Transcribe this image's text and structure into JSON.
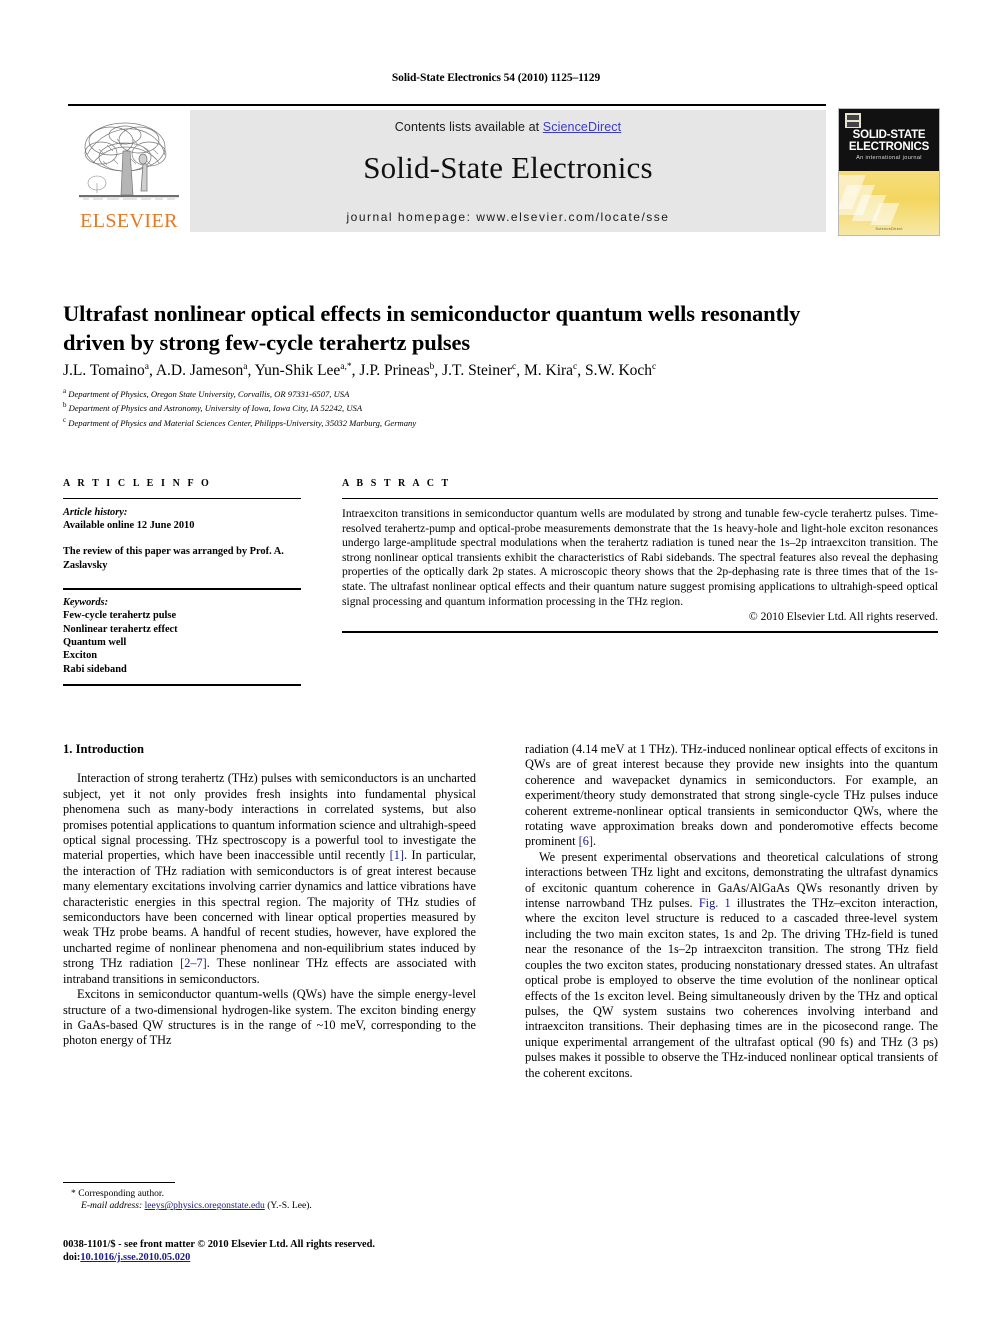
{
  "running_head": "Solid-State Electronics 54 (2010) 1125–1129",
  "banner": {
    "contents_prefix": "Contents lists available at ",
    "sciencedirect": "ScienceDirect",
    "journal_title": "Solid-State Electronics",
    "homepage": "journal homepage: www.elsevier.com/locate/sse",
    "publisher_wordmark": "ELSEVIER"
  },
  "cover": {
    "line1": "SOLID-STATE",
    "line2": "ELECTRONICS",
    "subtitle": "An international journal",
    "footer": "ScienceDirect"
  },
  "article": {
    "title": "Ultrafast nonlinear optical effects in semiconductor quantum wells resonantly driven by strong few-cycle terahertz pulses",
    "authors": "J.L. Tomaino a, A.D. Jameson a, Yun-Shik Lee a,*, J.P. Prineas b, J.T. Steiner c, M. Kira c, S.W. Koch c",
    "affiliations": [
      "a Department of Physics, Oregon State University, Corvallis, OR 97331-6507, USA",
      "b Department of Physics and Astronomy, University of Iowa, Iowa City, IA 52242, USA",
      "c Department of Physics and Material Sciences Center, Philipps-University, 35032 Marburg, Germany"
    ]
  },
  "info": {
    "heading": "A R T I C L E   I N F O",
    "history_label": "Article history:",
    "history_value": "Available online 12 June 2010",
    "review_note": "The review of this paper was arranged by Prof. A. Zaslavsky",
    "keywords_label": "Keywords:",
    "keywords": [
      "Few-cycle terahertz pulse",
      "Nonlinear terahertz effect",
      "Quantum well",
      "Exciton",
      "Rabi sideband"
    ]
  },
  "abstract": {
    "heading": "A B S T R A C T",
    "text": "Intraexciton transitions in semiconductor quantum wells are modulated by strong and tunable few-cycle terahertz pulses. Time-resolved terahertz-pump and optical-probe measurements demonstrate that the 1s heavy-hole and light-hole exciton resonances undergo large-amplitude spectral modulations when the terahertz radiation is tuned near the 1s–2p intraexciton transition. The strong nonlinear optical transients exhibit the characteristics of Rabi sidebands. The spectral features also reveal the dephasing properties of the optically dark 2p states. A microscopic theory shows that the 2p-dephasing rate is three times that of the 1s-state. The ultrafast nonlinear optical effects and their quantum nature suggest promising applications to ultrahigh-speed optical signal processing and quantum information processing in the THz region.",
    "copyright": "© 2010 Elsevier Ltd. All rights reserved."
  },
  "body": {
    "section_heading": "1. Introduction",
    "left_paragraphs": [
      "Interaction of strong terahertz (THz) pulses with semiconductors is an uncharted subject, yet it not only provides fresh insights into fundamental physical phenomena such as many-body interactions in correlated systems, but also promises potential applications to quantum information science and ultrahigh-speed optical signal processing. THz spectroscopy is a powerful tool to investigate the material properties, which have been inaccessible until recently [1]. In particular, the interaction of THz radiation with semiconductors is of great interest because many elementary excitations involving carrier dynamics and lattice vibrations have characteristic energies in this spectral region. The majority of THz studies of semiconductors have been concerned with linear optical properties measured by weak THz probe beams. A handful of recent studies, however, have explored the uncharted regime of nonlinear phenomena and non-equilibrium states induced by strong THz radiation [2–7]. These nonlinear THz effects are associated with intraband transitions in semiconductors.",
      "Excitons in semiconductor quantum-wells (QWs) have the simple energy-level structure of a two-dimensional hydrogen-like system. The exciton binding energy in GaAs-based QW structures is in the range of ~10 meV, corresponding to the photon energy of THz"
    ],
    "right_paragraphs": [
      "radiation (4.14 meV at 1 THz). THz-induced nonlinear optical effects of excitons in QWs are of great interest because they provide new insights into the quantum coherence and wavepacket dynamics in semiconductors. For example, an experiment/theory study demonstrated that strong single-cycle THz pulses induce coherent extreme-nonlinear optical transients in semiconductor QWs, where the rotating wave approximation breaks down and ponderomotive effects become prominent [6].",
      "We present experimental observations and theoretical calculations of strong interactions between THz light and excitons, demonstrating the ultrafast dynamics of excitonic quantum coherence in GaAs/AlGaAs QWs resonantly driven by intense narrowband THz pulses. Fig. 1 illustrates the THz–exciton interaction, where the exciton level structure is reduced to a cascaded three-level system including the two main exciton states, 1s and 2p. The driving THz-field is tuned near the resonance of the 1s–2p intraexciton transition. The strong THz field couples the two exciton states, producing nonstationary dressed states. An ultrafast optical probe is employed to observe the time evolution of the nonlinear optical effects of the 1s exciton level. Being simultaneously driven by the THz and optical pulses, the QW system sustains two coherences involving interband and intraexciton transitions. Their dephasing times are in the picosecond range. The unique experimental arrangement of the ultrafast optical (90 fs) and THz (3 ps) pulses makes it possible to observe the THz-induced nonlinear optical transients of the coherent excitons."
    ]
  },
  "footnotes": {
    "corresponding": "* Corresponding author.",
    "email_label": "E-mail address:",
    "email": "leeys@physics.oregonstate.edu",
    "email_suffix": "(Y.-S. Lee).",
    "imprint": "0038-1101/$ - see front matter © 2010 Elsevier Ltd. All rights reserved.",
    "doi_label": "doi:",
    "doi": "10.1016/j.sse.2010.05.020"
  },
  "colors": {
    "link": "#3a3ad0",
    "cite": "#1a1a8c",
    "elsevier_orange": "#E87722",
    "banner_grey": "#e6e6e6",
    "cover_yellow": "#f3d65f"
  }
}
